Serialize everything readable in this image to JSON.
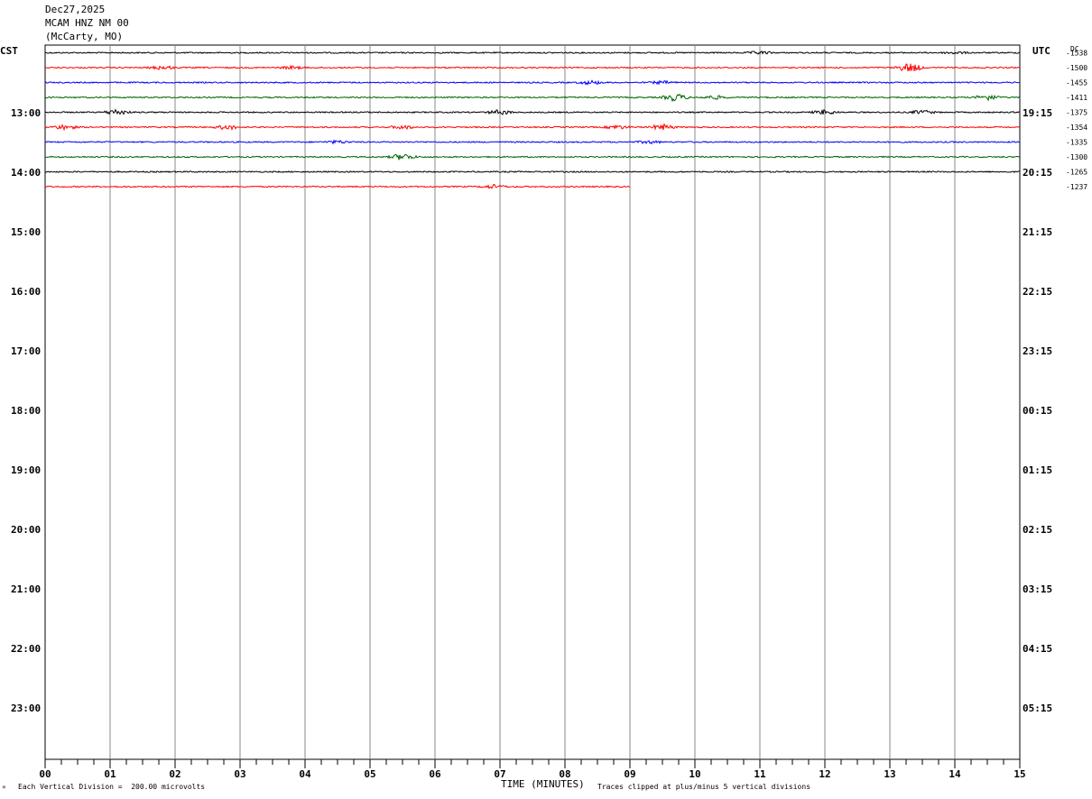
{
  "header": {
    "date": "Dec27,2025",
    "station": "MCAM HNZ NM 00",
    "location": "(McCarty, MO)"
  },
  "left_tz": "CST",
  "right_tz": "UTC",
  "dc_label": "DC",
  "footer": {
    "corner_mark": "ᴹ",
    "scale_note": "Each Vertical Division =  200.00 microvolts",
    "xlabel": "TIME (MINUTES)",
    "clip_note": "Traces clipped at plus/minus 5 vertical divisions"
  },
  "colors": [
    "#000000",
    "#ff0000",
    "#0000ff",
    "#006400"
  ],
  "chart_data": {
    "type": "line",
    "title": "MCAM HNZ NM 00",
    "xlabel": "TIME (MINUTES)",
    "xlim": [
      0,
      15
    ],
    "x_ticks": [
      "00",
      "01",
      "02",
      "03",
      "04",
      "05",
      "06",
      "07",
      "08",
      "09",
      "10",
      "11",
      "12",
      "13",
      "14",
      "15"
    ],
    "hour_labels_left": [
      "13:00",
      "14:00",
      "15:00",
      "16:00",
      "17:00",
      "18:00",
      "19:00",
      "20:00",
      "21:00",
      "22:00",
      "23:00"
    ],
    "hour_labels_right": [
      "19:15",
      "20:15",
      "21:15",
      "22:15",
      "23:15",
      "00:15",
      "01:15",
      "02:15",
      "03:15",
      "04:15",
      "05:15"
    ],
    "traces": [
      {
        "dc": "-1538",
        "end_min": 15,
        "events": [
          [
            11.0,
            1.5
          ],
          [
            14.0,
            1.2
          ]
        ]
      },
      {
        "dc": "-1500",
        "end_min": 15,
        "events": [
          [
            1.8,
            2.0
          ],
          [
            3.8,
            1.5
          ],
          [
            13.3,
            5.0
          ]
        ]
      },
      {
        "dc": "-1455",
        "end_min": 15,
        "events": [
          [
            8.4,
            2.0
          ],
          [
            9.5,
            1.5
          ]
        ]
      },
      {
        "dc": "-1411",
        "end_min": 15,
        "events": [
          [
            9.7,
            4.0
          ],
          [
            10.3,
            2.0
          ],
          [
            14.5,
            3.0
          ]
        ]
      },
      {
        "dc": "-1375",
        "end_min": 15,
        "events": [
          [
            1.1,
            3.0
          ],
          [
            7.0,
            2.5
          ],
          [
            12.0,
            2.5
          ],
          [
            13.5,
            2.0
          ]
        ]
      },
      {
        "dc": "-1354",
        "end_min": 15,
        "events": [
          [
            0.3,
            2.5
          ],
          [
            2.8,
            2.5
          ],
          [
            5.5,
            2.0
          ],
          [
            8.8,
            2.0
          ],
          [
            9.5,
            3.0
          ]
        ]
      },
      {
        "dc": "-1335",
        "end_min": 15,
        "events": [
          [
            4.5,
            1.5
          ],
          [
            9.3,
            1.5
          ]
        ]
      },
      {
        "dc": "-1300",
        "end_min": 15,
        "events": [
          [
            5.5,
            3.5
          ]
        ]
      },
      {
        "dc": "-1265",
        "end_min": 15,
        "events": []
      },
      {
        "dc": "-1237",
        "end_min": 9,
        "events": [
          [
            6.9,
            2.0
          ]
        ]
      }
    ]
  }
}
